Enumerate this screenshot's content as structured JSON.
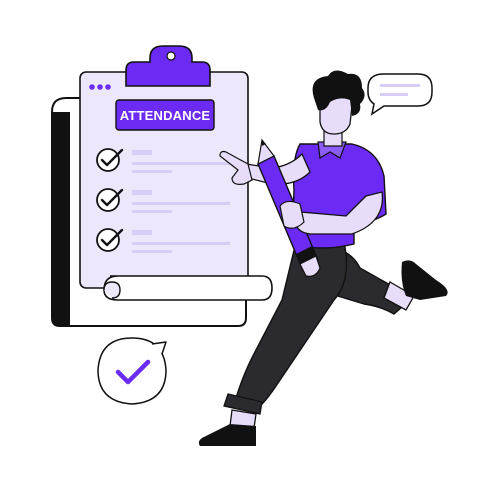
{
  "clipboard": {
    "title": "ATTENDANCE",
    "rows": [
      {
        "checked": true
      },
      {
        "checked": true
      },
      {
        "checked": true
      }
    ]
  },
  "colors": {
    "accent": "#6C2BF5",
    "accent_light": "#8B5CF6",
    "lavender": "#EDE7FB",
    "lavender_mid": "#DCD2F7",
    "ink": "#111111",
    "pants": "#2B2A2E",
    "skin": "#E7DDFB",
    "white": "#FFFFFF"
  },
  "icons": {
    "speech_bubble_top": "chat-bubble-icon",
    "speech_bubble_bottom": "check-bubble-icon",
    "row_check": "check-circle-icon"
  }
}
